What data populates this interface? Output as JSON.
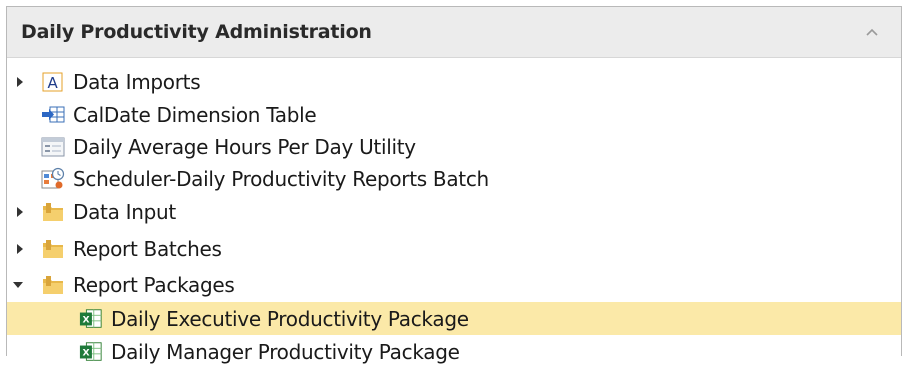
{
  "header": {
    "title": "Daily Productivity Administration"
  },
  "tree": {
    "items": [
      {
        "label": "Data Imports",
        "icon": "text-A-icon",
        "expander": "collapsed"
      },
      {
        "label": "CalDate Dimension Table",
        "icon": "table-import-icon",
        "expander": "none"
      },
      {
        "label": "Daily Average Hours Per Day Utility",
        "icon": "form-window-icon",
        "expander": "none"
      },
      {
        "label": "Scheduler-Daily Productivity Reports Batch",
        "icon": "scheduler-icon",
        "expander": "none"
      },
      {
        "label": "Data Input",
        "icon": "folder-icon",
        "expander": "collapsed"
      },
      {
        "label": "Report Batches",
        "icon": "folder-icon",
        "expander": "collapsed"
      },
      {
        "label": "Report Packages",
        "icon": "folder-icon",
        "expander": "expanded"
      },
      {
        "label": "Daily Executive Productivity Package",
        "icon": "excel-package-icon",
        "expander": "none",
        "selected": true
      },
      {
        "label": "Daily Manager Productivity Package",
        "icon": "excel-package-icon",
        "expander": "none"
      }
    ]
  },
  "colors": {
    "selection": "#fbe9a8",
    "header_bg": "#ececec",
    "folder": "#e8b84a"
  }
}
